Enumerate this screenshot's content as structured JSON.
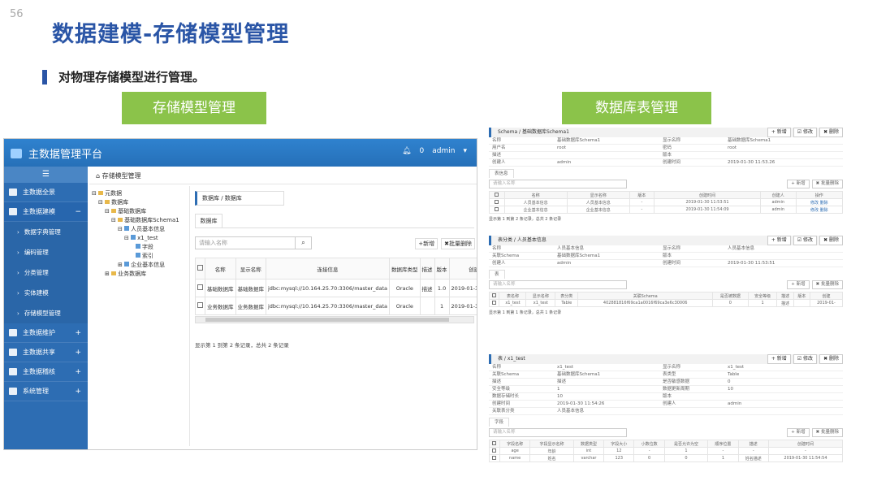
{
  "slide": {
    "page_number": "56",
    "title": "数据建模-存储模型管理",
    "subtitle": "对物理存储模型进行管理。",
    "label_left": "存储模型管理",
    "label_right": "数据库表管理",
    "colors": {
      "title": "#2a55a6",
      "label_bg": "#8bc34a",
      "app_blue": "#2d6db3"
    }
  },
  "app": {
    "brand": "主数据管理平台",
    "notify_count": "0",
    "user": "admin",
    "sidebar": {
      "menu_icon": "☰",
      "items": [
        {
          "label": "主数据全景",
          "icon": "monitor-icon"
        },
        {
          "label": "主数据建模",
          "icon": "gear-icon",
          "expanded": true
        },
        {
          "label": "主数据维护",
          "icon": "list-icon"
        },
        {
          "label": "主数据共享",
          "icon": "share-icon"
        },
        {
          "label": "主数据稽核",
          "icon": "refresh-icon"
        },
        {
          "label": "系统管理",
          "icon": "cogs-icon"
        }
      ],
      "subitems": [
        "数据字典管理",
        "编码管理",
        "分类管理",
        "实体建模",
        "存储模型管理"
      ]
    },
    "page_header": "存储模型管理",
    "tree": {
      "root": "元数据",
      "db": "数据库",
      "base_db": "基础数据库",
      "schema": "基础数据库Schema1",
      "person": "人员基本信息",
      "x1": "x1_test",
      "field": "字段",
      "index": "索引",
      "company": "企业基本信息",
      "biz_db": "业务数据库"
    },
    "content": {
      "breadcrumb": "数据库 / 数据库",
      "tab": "数据库",
      "search_placeholder": "请输入名称",
      "add": "+新增",
      "batch_delete": "✖批量删除",
      "columns": [
        "名称",
        "显示名称",
        "连接信息",
        "数据库类型",
        "描述",
        "版本",
        "创建时间"
      ],
      "rows": [
        [
          "基础数据库",
          "基础数据库",
          "jdbc:mysql://10.164.25.70:3306/master_data",
          "Oracle",
          "描述",
          "1.0",
          "2019-01-30 10:07:37"
        ],
        [
          "业务数据库",
          "业务数据库",
          "jdbc:mysql://10.164.25.70:3306/master_data",
          "Oracle",
          "",
          "1",
          "2019-01-30 11:51:52"
        ]
      ],
      "footer": "显示第 1 到第 2 条记录，总共 2 条记录"
    }
  },
  "panels": {
    "btn_add": "+ 新增",
    "btn_edit": "☑ 修改",
    "btn_delete": "✖ 删除",
    "btn_batch": "✖ 批量删除",
    "search": "请输入名称",
    "p1": {
      "header": "Schema / 基础数据库Schema1",
      "kv": [
        "名称",
        "基础数据库Schema1",
        "显示名称",
        "基础数据库Schema1",
        "用户名",
        "root",
        "密码",
        "root",
        "描述",
        "",
        "版本",
        "",
        "创建人",
        "admin",
        "创建时间",
        "2019-01-30 11:53.26"
      ],
      "tab": "表信息",
      "cols": [
        "",
        "名称",
        "显示名称",
        "版本",
        "创建时间",
        "创建人",
        "操作"
      ],
      "rows": [
        [
          "",
          "人员基本信息",
          "人员基本信息",
          "-",
          "2019-01-30 11:53:51",
          "admin",
          "修改 删除"
        ],
        [
          "",
          "企业基本信息",
          "企业基本信息",
          "-",
          "2019-01-30 11:54:09",
          "admin",
          "修改 删除"
        ]
      ],
      "footer": "显示第 1 到第 2 条记录，总共 2 条记录"
    },
    "p2": {
      "header": "表分类 / 人员基本信息",
      "kv": [
        "名称",
        "人员基本信息",
        "显示名称",
        "人员基本信息",
        "关联Schema",
        "基础数据库Schema1",
        "版本",
        "",
        "创建人",
        "admin",
        "创建时间",
        "2019-01-30 11:53:51"
      ],
      "tab": "表",
      "cols": [
        "",
        "表名称",
        "显示名称",
        "表分类",
        "关联Schema",
        "是否被数据",
        "安全等级",
        "描述",
        "版本",
        "创建"
      ],
      "rows": [
        [
          "",
          "x1_test",
          "x1_test",
          "Table",
          "402881816f69ca1a0016f69ca3e6c30006",
          "0",
          "1",
          "描述",
          "",
          "2019-01-"
        ]
      ],
      "footer": "显示第 1 到第 1 条记录，总共 1 条记录"
    },
    "p3": {
      "header": "表 / x1_test",
      "kv": [
        "名称",
        "x1_test",
        "显示名称",
        "x1_test",
        "关联Schema",
        "基础数据库Schema1",
        "表类型",
        "Table",
        "描述",
        "描述",
        "是否敏感数据",
        "0",
        "安全等级",
        "1",
        "数据更新周期",
        "10",
        "数据存储时长",
        "10",
        "版本",
        "",
        "创建时间",
        "2019-01-30 11:54:26",
        "创建人",
        "admin",
        "关联表分类",
        "人员基本信息",
        "",
        ""
      ],
      "tab": "字段",
      "cols": [
        "",
        "字段名称",
        "字段显示名称",
        "数据类型",
        "字段大小",
        "小数位数",
        "是否允许为空",
        "顺序位置",
        "描述",
        "创建时间"
      ],
      "rows": [
        [
          "",
          "age",
          "年龄",
          "int",
          "12",
          "-",
          "1",
          "-",
          "-",
          "-"
        ],
        [
          "",
          "name",
          "姓名",
          "varchar",
          "123",
          "0",
          "0",
          "1",
          "姓名描述",
          "2019-01-30 11:54:54"
        ]
      ]
    }
  }
}
